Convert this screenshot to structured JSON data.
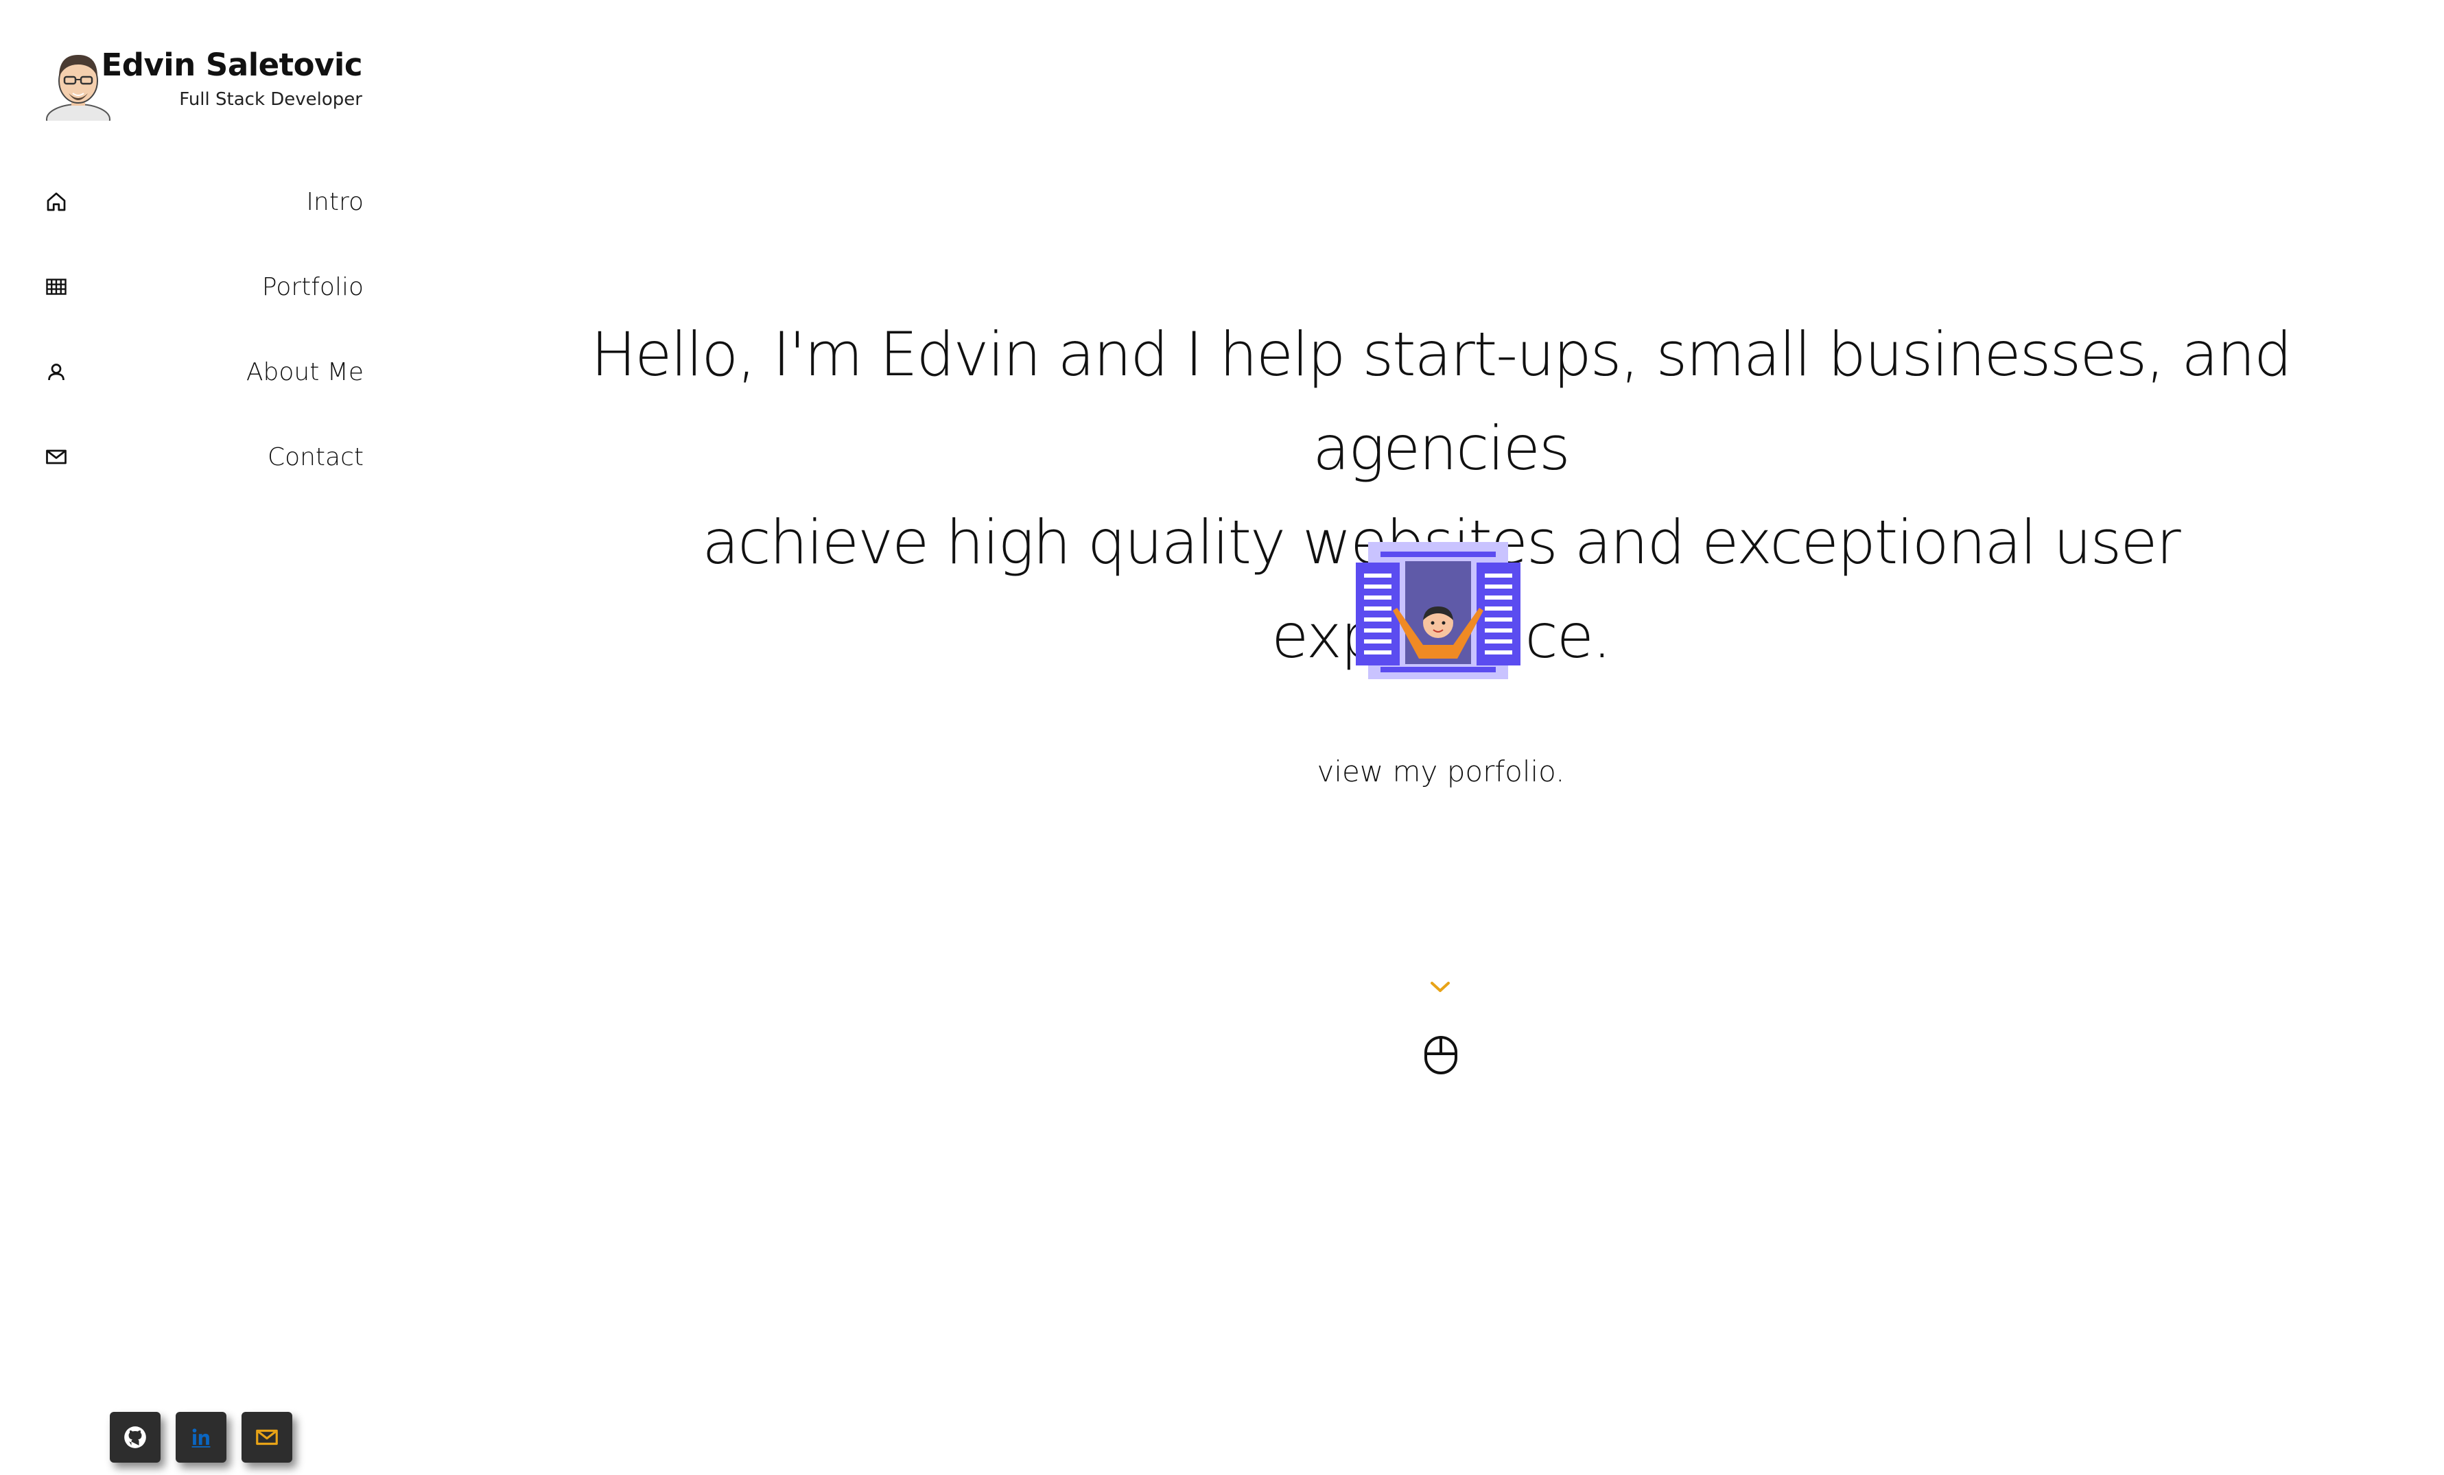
{
  "profile": {
    "name": "Edvin Saletovic",
    "role": "Full Stack Developer",
    "avatar_icon": "developer-avatar"
  },
  "nav": {
    "items": [
      {
        "label": "Intro",
        "icon": "home-icon"
      },
      {
        "label": "Portfolio",
        "icon": "grid-icon"
      },
      {
        "label": "About Me",
        "icon": "user-icon"
      },
      {
        "label": "Contact",
        "icon": "mail-icon"
      }
    ]
  },
  "hero": {
    "line1": "Hello, I'm Edvin and I help start-ups, small businesses, and agencies",
    "line2": "achieve high quality websites and exceptional user experience."
  },
  "cta": {
    "link_text": "view my porfolio."
  },
  "scroll": {
    "chevron_icon": "chevron-down-icon",
    "mouse_icon": "mouse-icon"
  },
  "social": [
    {
      "icon": "github-icon"
    },
    {
      "icon": "linkedin-icon"
    },
    {
      "icon": "email-icon"
    }
  ],
  "colors": {
    "accent": "#e8a317",
    "shutter": "#5b4cf0",
    "shutter_light": "#c9c3ff",
    "window_dark": "#5f5aa8",
    "figure_orange": "#f08a24",
    "social_bg": "#2d2d2d",
    "linkedin": "#0a66c2"
  }
}
